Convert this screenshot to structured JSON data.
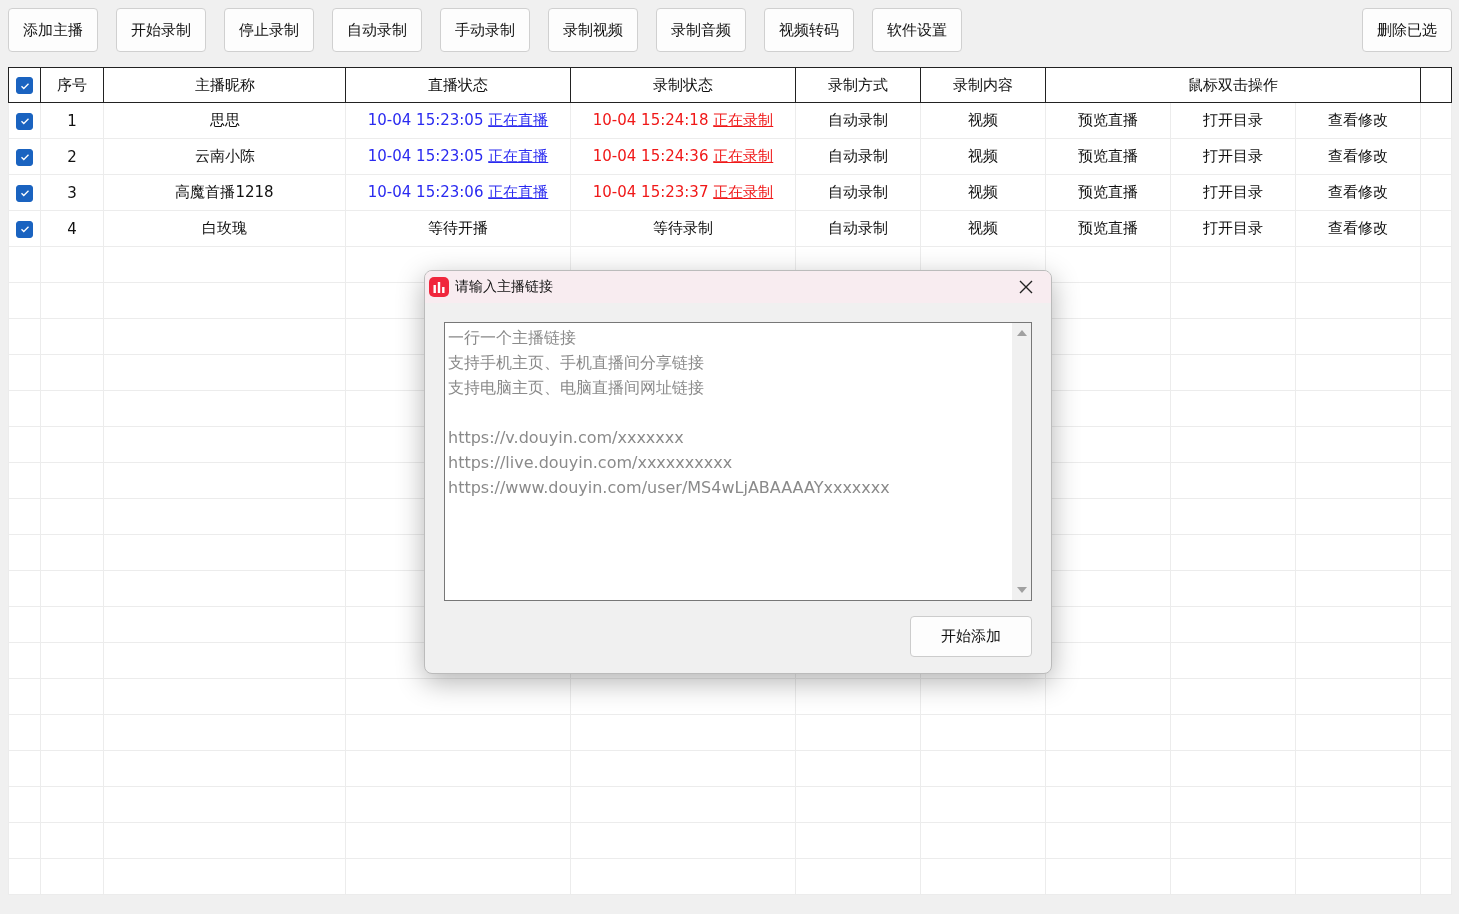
{
  "toolbar": {
    "buttons": [
      "添加主播",
      "开始录制",
      "停止录制",
      "自动录制",
      "手动录制",
      "录制视频",
      "录制音频",
      "视频转码",
      "软件设置"
    ],
    "right_button": "删除已选"
  },
  "table": {
    "all_checked": true,
    "columns": [
      "序号",
      "主播昵称",
      "直播状态",
      "录制状态",
      "录制方式",
      "录制内容",
      "鼠标双击操作"
    ],
    "rows": [
      {
        "checked": true,
        "no": "1",
        "name": "思思",
        "live": {
          "kind": "live",
          "time": "10-04 15:23:05",
          "text": "正在直播"
        },
        "record": {
          "kind": "recording",
          "time": "10-04 15:24:18",
          "text": "正在录制"
        },
        "mode": "自动录制",
        "content": "视频",
        "actions": [
          "预览直播",
          "打开目录",
          "查看修改"
        ]
      },
      {
        "checked": true,
        "no": "2",
        "name": "云南小陈",
        "live": {
          "kind": "live",
          "time": "10-04 15:23:05",
          "text": "正在直播"
        },
        "record": {
          "kind": "recording",
          "time": "10-04 15:24:36",
          "text": "正在录制"
        },
        "mode": "自动录制",
        "content": "视频",
        "actions": [
          "预览直播",
          "打开目录",
          "查看修改"
        ]
      },
      {
        "checked": true,
        "no": "3",
        "name": "高魔首播1218",
        "live": {
          "kind": "live",
          "time": "10-04 15:23:06",
          "text": "正在直播"
        },
        "record": {
          "kind": "recording",
          "time": "10-04 15:23:37",
          "text": "正在录制"
        },
        "mode": "自动录制",
        "content": "视频",
        "actions": [
          "预览直播",
          "打开目录",
          "查看修改"
        ]
      },
      {
        "checked": true,
        "no": "4",
        "name": "白玫瑰",
        "live": {
          "kind": "waiting",
          "text": "等待开播"
        },
        "record": {
          "kind": "waiting",
          "text": "等待录制"
        },
        "mode": "自动录制",
        "content": "视频",
        "actions": [
          "预览直播",
          "打开目录",
          "查看修改"
        ]
      }
    ]
  },
  "dialog": {
    "title": "请输入主播链接",
    "placeholder": [
      [
        "一行一个主播链接",
        "支持手机主页、手机直播间分享链接",
        "支持电脑主页、电脑直播间网址链接"
      ],
      [
        "https://v.douyin.com/xxxxxxx",
        "https://live.douyin.com/xxxxxxxxxx",
        "https://www.douyin.com/user/MS4wLjABAAAAYxxxxxxx"
      ]
    ],
    "button": "开始添加"
  }
}
